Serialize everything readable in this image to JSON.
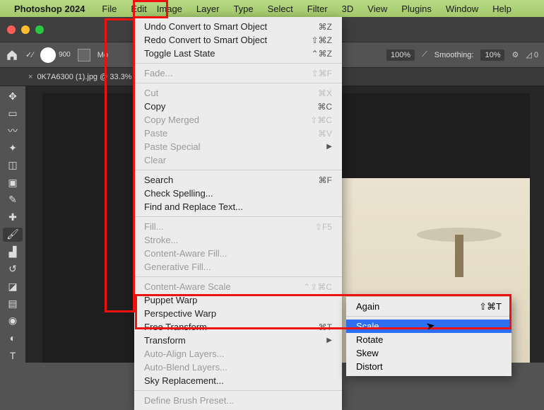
{
  "menubar": {
    "app": "Photoshop 2024",
    "items": [
      "File",
      "Edit",
      "Image",
      "Layer",
      "Type",
      "Select",
      "Filter",
      "3D",
      "View",
      "Plugins",
      "Window",
      "Help"
    ]
  },
  "options": {
    "brush_size": "900",
    "mode_label": "Mo",
    "zoom": "100%",
    "smoothing_label": "Smoothing:",
    "smoothing_value": "10%"
  },
  "tab": {
    "title": "0K7A6300 (1).jpg @ 33.3%"
  },
  "edit_menu": [
    {
      "label": "Undo Convert to Smart Object",
      "sc": "⌘Z"
    },
    {
      "label": "Redo Convert to Smart Object",
      "sc": "⇧⌘Z"
    },
    {
      "label": "Toggle Last State",
      "sc": "⌃⌘Z"
    },
    "sep",
    {
      "label": "Fade...",
      "sc": "⇧⌘F",
      "disabled": true
    },
    "sep",
    {
      "label": "Cut",
      "sc": "⌘X",
      "disabled": true
    },
    {
      "label": "Copy",
      "sc": "⌘C"
    },
    {
      "label": "Copy Merged",
      "sc": "⇧⌘C",
      "disabled": true
    },
    {
      "label": "Paste",
      "sc": "⌘V",
      "disabled": true
    },
    {
      "label": "Paste Special",
      "arrow": true,
      "disabled": true
    },
    {
      "label": "Clear",
      "disabled": true
    },
    "sep",
    {
      "label": "Search",
      "sc": "⌘F"
    },
    {
      "label": "Check Spelling..."
    },
    {
      "label": "Find and Replace Text..."
    },
    "sep",
    {
      "label": "Fill...",
      "sc": "⇧F5",
      "disabled": true
    },
    {
      "label": "Stroke...",
      "disabled": true
    },
    {
      "label": "Content-Aware Fill...",
      "disabled": true
    },
    {
      "label": "Generative Fill...",
      "disabled": true
    },
    "sep",
    {
      "label": "Content-Aware Scale",
      "sc": "⌃⇧⌘C",
      "disabled": true
    },
    {
      "label": "Puppet Warp"
    },
    {
      "label": "Perspective Warp"
    },
    {
      "label": "Free Transform",
      "sc": "⌘T"
    },
    {
      "label": "Transform",
      "arrow": true
    },
    {
      "label": "Auto-Align Layers...",
      "disabled": true
    },
    {
      "label": "Auto-Blend Layers...",
      "disabled": true
    },
    {
      "label": "Sky Replacement..."
    },
    "sep",
    {
      "label": "Define Brush Preset...",
      "disabled": true
    }
  ],
  "transform_submenu": [
    {
      "label": "Again",
      "sc": "⇧⌘T",
      "disabled": true
    },
    "sep",
    {
      "label": "Scale",
      "highlight": true
    },
    {
      "label": "Rotate"
    },
    {
      "label": "Skew"
    },
    {
      "label": "Distort"
    }
  ]
}
